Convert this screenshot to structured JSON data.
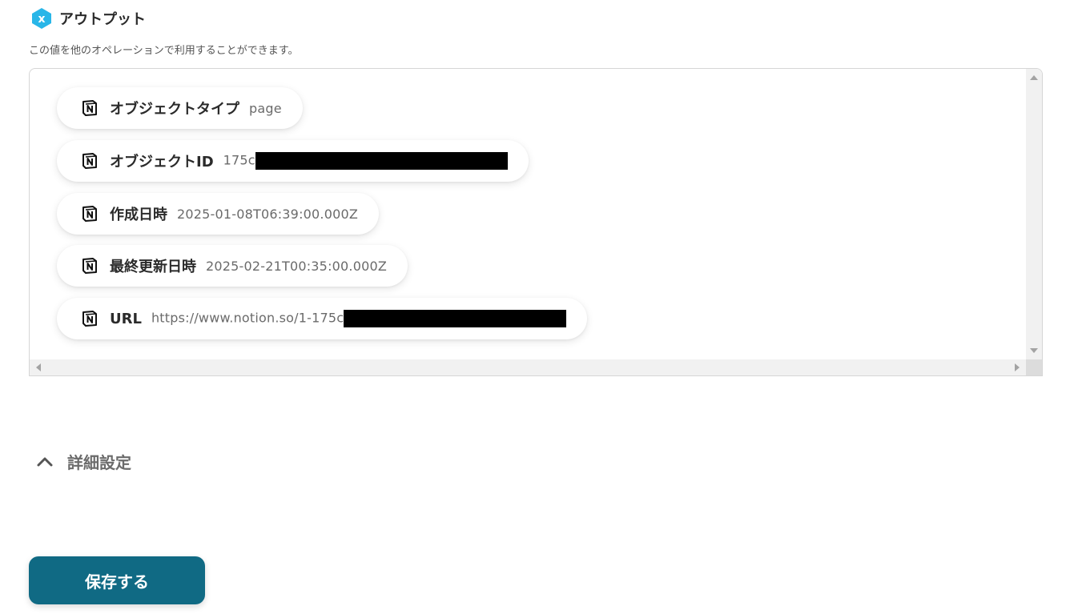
{
  "output_section": {
    "title": "アウトプット",
    "description": "この値を他のオペレーションで利用することができます。",
    "icon": "variable-icon",
    "accent_color": "#29b6e8"
  },
  "output_items": [
    {
      "icon": "notion-icon",
      "label": "オブジェクトタイプ",
      "value": "page"
    },
    {
      "icon": "notion-icon",
      "label": "オブジェクトID",
      "value": "175c",
      "redacted": true
    },
    {
      "icon": "notion-icon",
      "label": "作成日時",
      "value": "2025-01-08T06:39:00.000Z"
    },
    {
      "icon": "notion-icon",
      "label": "最終更新日時",
      "value": "2025-02-21T00:35:00.000Z"
    },
    {
      "icon": "notion-icon",
      "label": "URL",
      "value": "https://www.notion.so/1-175c",
      "redacted": true
    }
  ],
  "details": {
    "label": "詳細設定",
    "icon": "chevron-up-icon",
    "expanded": true
  },
  "save_button": {
    "label": "保存する",
    "color": "#106a84"
  }
}
